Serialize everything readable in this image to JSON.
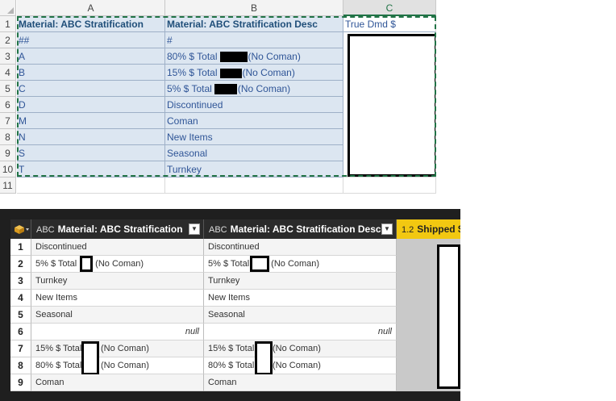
{
  "excel": {
    "columns": [
      "A",
      "B",
      "C"
    ],
    "row_numbers": [
      "1",
      "2",
      "3",
      "4",
      "5",
      "6",
      "7",
      "8",
      "9",
      "10",
      "11"
    ],
    "header": {
      "a": "Material: ABC Stratification",
      "b": "Material: ABC Stratification Desc",
      "c": "True Dmd $"
    },
    "rows": [
      {
        "a": "##",
        "b_pre": "#",
        "b_post": ""
      },
      {
        "a": "A",
        "b_pre": "80% $ Total",
        "b_post": "(No Coman)"
      },
      {
        "a": "B",
        "b_pre": "15% $ Total",
        "b_post": "(No Coman)"
      },
      {
        "a": "C",
        "b_pre": "5% $ Total",
        "b_post": "(No Coman)"
      },
      {
        "a": "D",
        "b_pre": "Discontinued",
        "b_post": ""
      },
      {
        "a": "M",
        "b_pre": "Coman",
        "b_post": ""
      },
      {
        "a": "N",
        "b_pre": "New Items",
        "b_post": ""
      },
      {
        "a": "S",
        "b_pre": "Seasonal",
        "b_post": ""
      },
      {
        "a": "T",
        "b_pre": "Turnkey",
        "b_post": ""
      }
    ]
  },
  "power_query": {
    "columns": [
      {
        "type": "ABC",
        "name": "Material: ABC Stratification"
      },
      {
        "type": "ABC",
        "name": "Material: ABC Stratification Desc"
      },
      {
        "type": "1.2",
        "name": "Shipped $"
      }
    ],
    "rows": [
      {
        "n": "1",
        "a_pre": "Discontinued",
        "a_post": "",
        "b_pre": "Discontinued",
        "b_post": ""
      },
      {
        "n": "2",
        "a_pre": "5% $ Total",
        "a_post": "(No Coman)",
        "b_pre": "5% $ Total",
        "b_post": "(No Coman)"
      },
      {
        "n": "3",
        "a_pre": "Turnkey",
        "a_post": "",
        "b_pre": "Turnkey",
        "b_post": ""
      },
      {
        "n": "4",
        "a_pre": "New Items",
        "a_post": "",
        "b_pre": "New Items",
        "b_post": ""
      },
      {
        "n": "5",
        "a_pre": "Seasonal",
        "a_post": "",
        "b_pre": "Seasonal",
        "b_post": ""
      },
      {
        "n": "6",
        "a_pre": "null",
        "a_post": "",
        "b_pre": "null",
        "b_post": ""
      },
      {
        "n": "7",
        "a_pre": "15% $ Total",
        "a_post": "(No Coman)",
        "b_pre": "15% $ Total",
        "b_post": "(No Coman)"
      },
      {
        "n": "8",
        "a_pre": "80% $ Total",
        "a_post": "(No Coman)",
        "b_pre": "80% $ Total",
        "b_post": "(No Coman)"
      },
      {
        "n": "9",
        "a_pre": "Coman",
        "a_post": "",
        "b_pre": "Coman",
        "b_post": ""
      }
    ]
  }
}
